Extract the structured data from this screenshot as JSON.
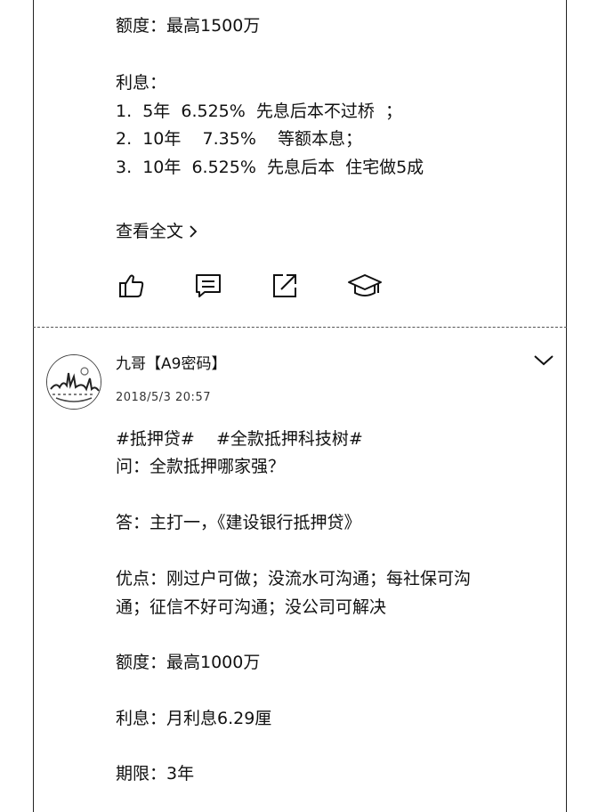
{
  "post1": {
    "amount": "额度：最高1500万",
    "interest_label": "利息：",
    "rate_lines": [
      "1.  5年  6.525%  先息后本不过桥  ；",
      "2.  10年    7.35%    等额本息；",
      "3.  10年  6.525%  先息后本  住宅做5成"
    ],
    "read_more": "查看全文",
    "actions": {
      "like_icon": "thumbs-up-icon",
      "comment_icon": "comment-icon",
      "share_icon": "share-icon",
      "course_icon": "graduation-cap-icon"
    }
  },
  "post2": {
    "author": "九哥【A9密码】",
    "timestamp": "2018/5/3 20:57",
    "tags": "#抵押贷#    #全款抵押科技树#",
    "question": "问：全款抵押哪家强？",
    "answer": "答：主打一，《建设银行抵押贷》",
    "advantages_line1": "优点：刚过户可做；没流水可沟通；每社保可沟",
    "advantages_line2": "通；征信不好可沟通；没公司可解决",
    "amount": "额度：最高1000万",
    "interest": "利息：月利息6.29厘",
    "term": "期限：3年"
  }
}
